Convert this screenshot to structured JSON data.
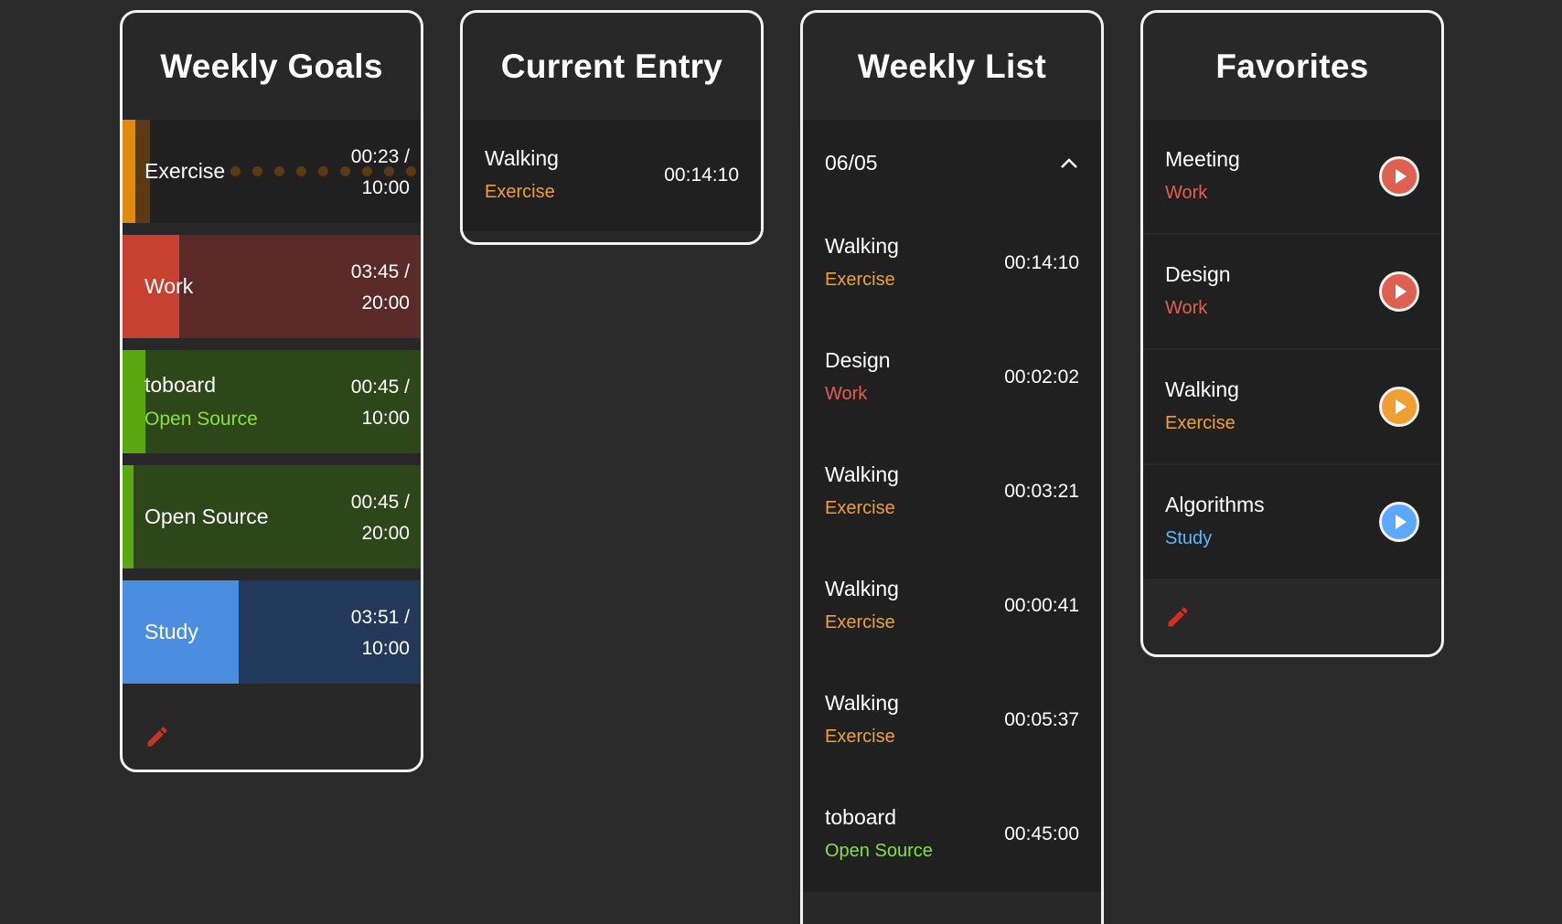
{
  "colors": {
    "exercise": "#f0a030",
    "work": "#e06050",
    "open_source": "#88e040",
    "study": "#5cb8ff"
  },
  "weekly_goals": {
    "title": "Weekly Goals",
    "items": [
      {
        "name": "Exercise",
        "category": "",
        "spent": "00:23 /",
        "goal": "10:00",
        "progress": 0.04
      },
      {
        "name": "Work",
        "category": "",
        "spent": "03:45 /",
        "goal": "20:00",
        "progress": 0.19
      },
      {
        "name": "toboard",
        "category": "Open Source",
        "spent": "00:45 /",
        "goal": "10:00",
        "progress": 0.075
      },
      {
        "name": "Open Source",
        "category": "",
        "spent": "00:45 /",
        "goal": "20:00",
        "progress": 0.0375
      },
      {
        "name": "Study",
        "category": "",
        "spent": "03:51 /",
        "goal": "10:00",
        "progress": 0.385
      }
    ],
    "edit_icon": "pencil-icon"
  },
  "current_entry": {
    "title": "Current Entry",
    "task": "Walking",
    "category": "Exercise",
    "duration": "00:14:10"
  },
  "weekly_list": {
    "title": "Weekly List",
    "date": "06/05",
    "collapse_icon": "chevron-up-icon",
    "entries": [
      {
        "task": "Walking",
        "category": "Exercise",
        "duration": "00:14:10"
      },
      {
        "task": "Design",
        "category": "Work",
        "duration": "00:02:02"
      },
      {
        "task": "Walking",
        "category": "Exercise",
        "duration": "00:03:21"
      },
      {
        "task": "Walking",
        "category": "Exercise",
        "duration": "00:00:41"
      },
      {
        "task": "Walking",
        "category": "Exercise",
        "duration": "00:05:37"
      },
      {
        "task": "toboard",
        "category": "Open Source",
        "duration": "00:45:00"
      }
    ]
  },
  "favorites": {
    "title": "Favorites",
    "items": [
      {
        "task": "Meeting",
        "category": "Work"
      },
      {
        "task": "Design",
        "category": "Work"
      },
      {
        "task": "Walking",
        "category": "Exercise"
      },
      {
        "task": "Algorithms",
        "category": "Study"
      }
    ],
    "edit_icon": "pencil-icon"
  }
}
